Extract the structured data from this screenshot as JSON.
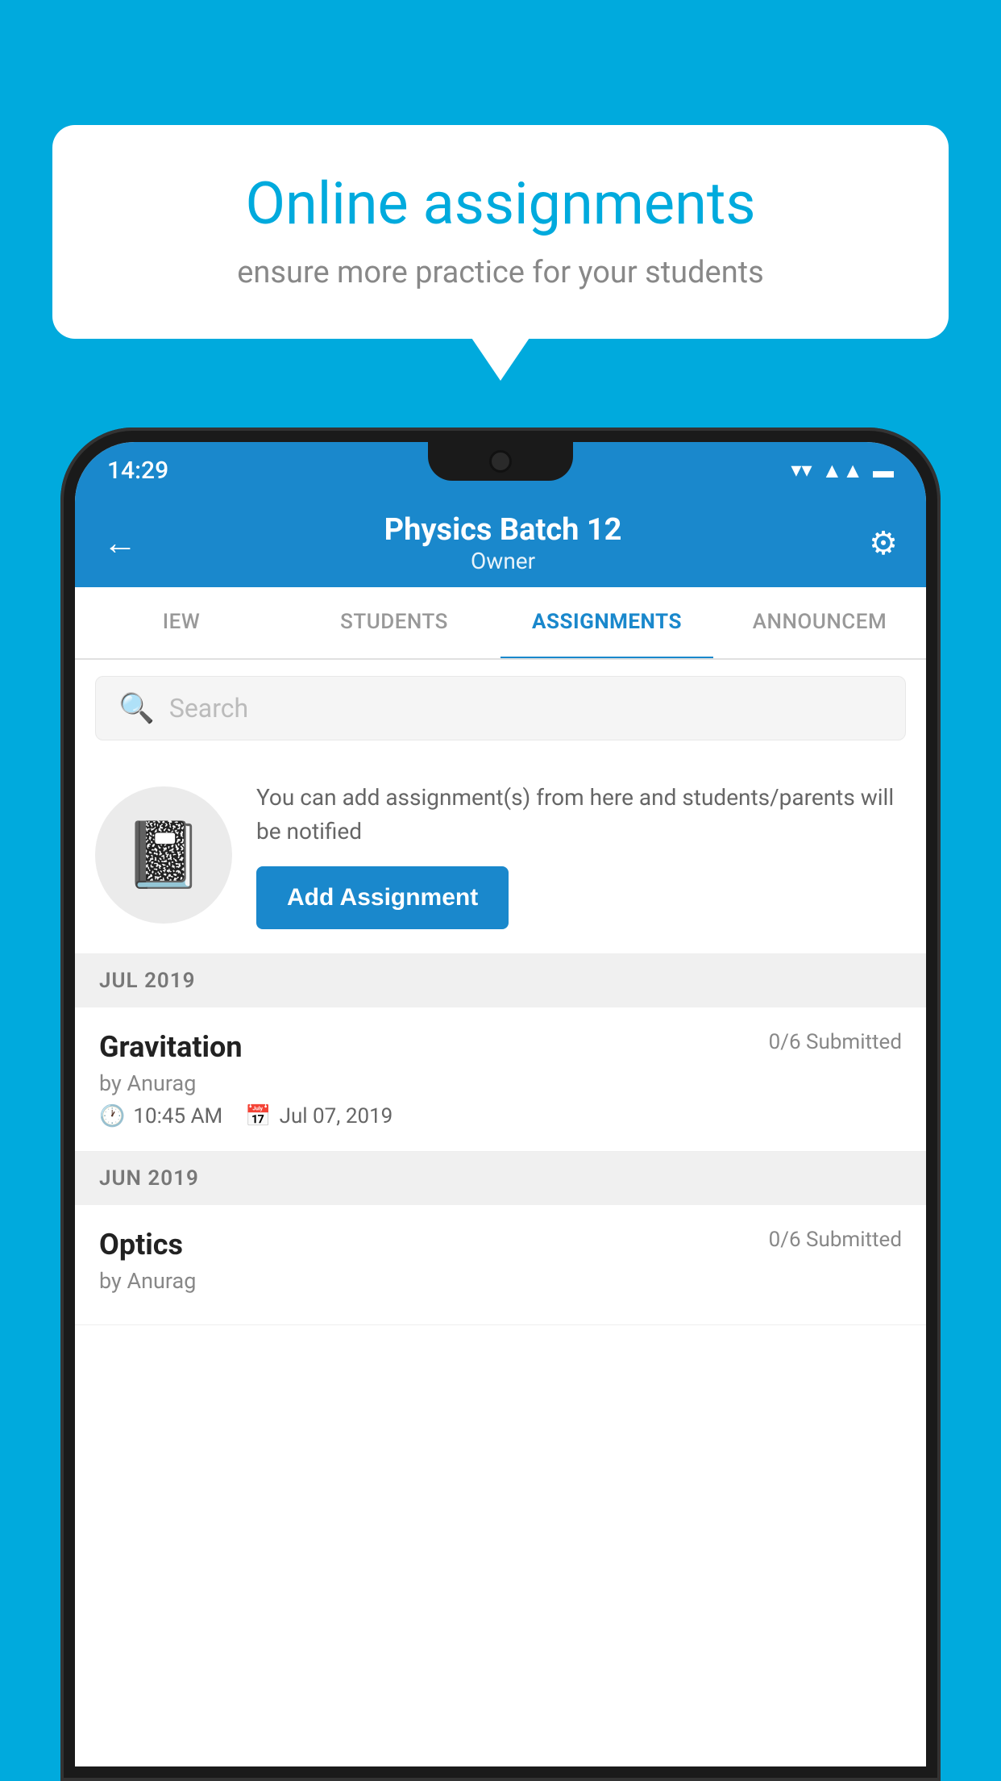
{
  "background": {
    "color": "#00AADD"
  },
  "promo_bubble": {
    "title": "Online assignments",
    "subtitle": "ensure more practice for your students"
  },
  "phone": {
    "status_bar": {
      "time": "14:29",
      "icons": [
        "wifi",
        "signal",
        "battery"
      ]
    },
    "header": {
      "title": "Physics Batch 12",
      "subtitle": "Owner",
      "back_label": "←",
      "settings_label": "⚙"
    },
    "tabs": [
      {
        "label": "IEW",
        "active": false
      },
      {
        "label": "STUDENTS",
        "active": false
      },
      {
        "label": "ASSIGNMENTS",
        "active": true
      },
      {
        "label": "ANNOUNCEM",
        "active": false
      }
    ],
    "search": {
      "placeholder": "Search"
    },
    "promo_section": {
      "icon": "📓",
      "description": "You can add assignment(s) from here and students/parents will be notified",
      "button_label": "Add Assignment"
    },
    "assignment_groups": [
      {
        "month_label": "JUL 2019",
        "assignments": [
          {
            "name": "Gravitation",
            "submitted": "0/6 Submitted",
            "author": "by Anurag",
            "time": "10:45 AM",
            "date": "Jul 07, 2019"
          }
        ]
      },
      {
        "month_label": "JUN 2019",
        "assignments": [
          {
            "name": "Optics",
            "submitted": "0/6 Submitted",
            "author": "by Anurag",
            "time": "",
            "date": ""
          }
        ]
      }
    ]
  }
}
